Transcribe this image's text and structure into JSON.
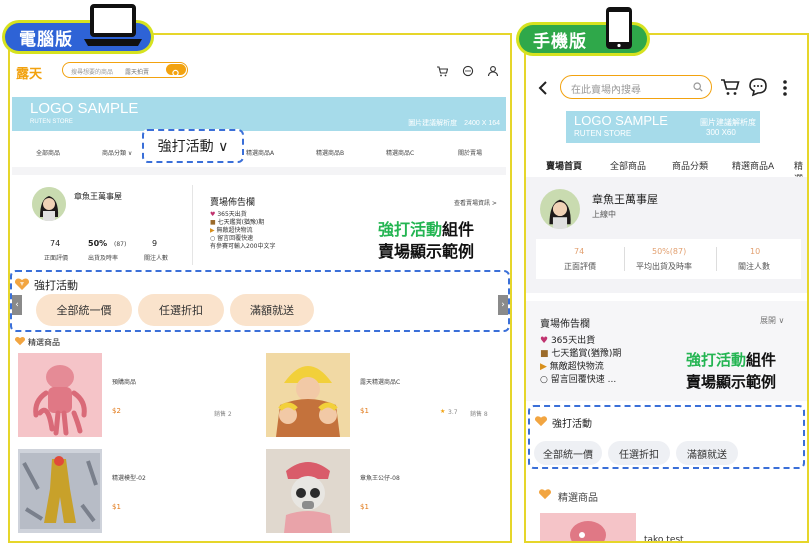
{
  "desktop": {
    "tag_label": "電腦版",
    "logo_text": "露天",
    "search_placeholder": "搜尋想要的商品",
    "search_scope": "露天拍賣",
    "banner_title": "LOGO SAMPLE",
    "banner_sub": "RUTEN STORE",
    "banner_note": "圖片建議解析度　2400 X 164",
    "nav": [
      "全部商品",
      "商品分類 ∨",
      "精選商品A",
      "精選商品B",
      "精選商品C",
      "關於賣場"
    ],
    "nav_highlight": "強打活動 ∨",
    "store_name": "章魚王萬事屋",
    "stats": [
      {
        "value": "74",
        "label": "正面評價"
      },
      {
        "value": "50%",
        "sub": "(87)",
        "label": "出貨及時率"
      },
      {
        "value": "9",
        "label": "關注人數"
      }
    ],
    "announce_title": "賣場佈告欄",
    "announce_more": "查看賣場資訊 >",
    "announce_lines": [
      "365天出貨",
      "七天鑑賞(猶豫)期",
      "無敵超快物流",
      "留言回覆快速",
      "有參賽可輸入200中文字"
    ],
    "promo_title": "強打活動",
    "promo_pills": [
      "全部統一價",
      "任選折扣",
      "滿額就送"
    ],
    "featured_title": "精選商品",
    "products": [
      {
        "name": "預購商品",
        "price": "$2",
        "sold": "銷售 2",
        "rating": ""
      },
      {
        "name": "露天精選商品C",
        "price": "$1",
        "sold": "銷售 8",
        "rating": "3.7"
      },
      {
        "name": "精選模型-02",
        "price": "$1",
        "sold": "",
        "rating": ""
      },
      {
        "name": "章魚王公仔-08",
        "price": "$1",
        "sold": "",
        "rating": ""
      }
    ],
    "annotation_line1_green": "強打活動",
    "annotation_line1_rest": "組件",
    "annotation_line2": "賣場顯示範例"
  },
  "mobile": {
    "tag_label": "手機版",
    "search_placeholder": "在此賣場內搜尋",
    "banner_title": "LOGO SAMPLE",
    "banner_sub": "RUTEN STORE",
    "banner_note1": "圖片建議解析度",
    "banner_note2": "300 X60",
    "tabs": [
      "賣場首頁",
      "全部商品",
      "商品分類",
      "精選商品A",
      "精選"
    ],
    "store_name": "章魚王萬事屋",
    "store_status": "上線中",
    "stats": [
      {
        "value": "74",
        "label": "正面評價"
      },
      {
        "value": "50%(87)",
        "label": "平均出貨及時率"
      },
      {
        "value": "10",
        "label": "關注人數"
      }
    ],
    "announce_title": "賣場佈告欄",
    "announce_expand": "展開",
    "announce_lines": [
      "365天出貨",
      "七天鑑賞(猶豫)期",
      "無敵超快物流",
      "留言回覆快速 ..."
    ],
    "promo_title": "強打活動",
    "promo_pills": [
      "全部統一價",
      "任選折扣",
      "滿額就送"
    ],
    "featured_title": "精選商品",
    "product_name": "tako test",
    "annotation_line1_green": "強打活動",
    "annotation_line1_rest": "組件",
    "annotation_line2": "賣場顯示範例"
  },
  "colors": {
    "accent_green": "#24b552",
    "tag_yellow": "#d6e21f",
    "desktop_tag": "#2e63d6",
    "mobile_tag": "#2fa84a",
    "banner": "#a6dbea",
    "dash": "#3a6fd8",
    "ruten_orange": "#f2a20f"
  }
}
